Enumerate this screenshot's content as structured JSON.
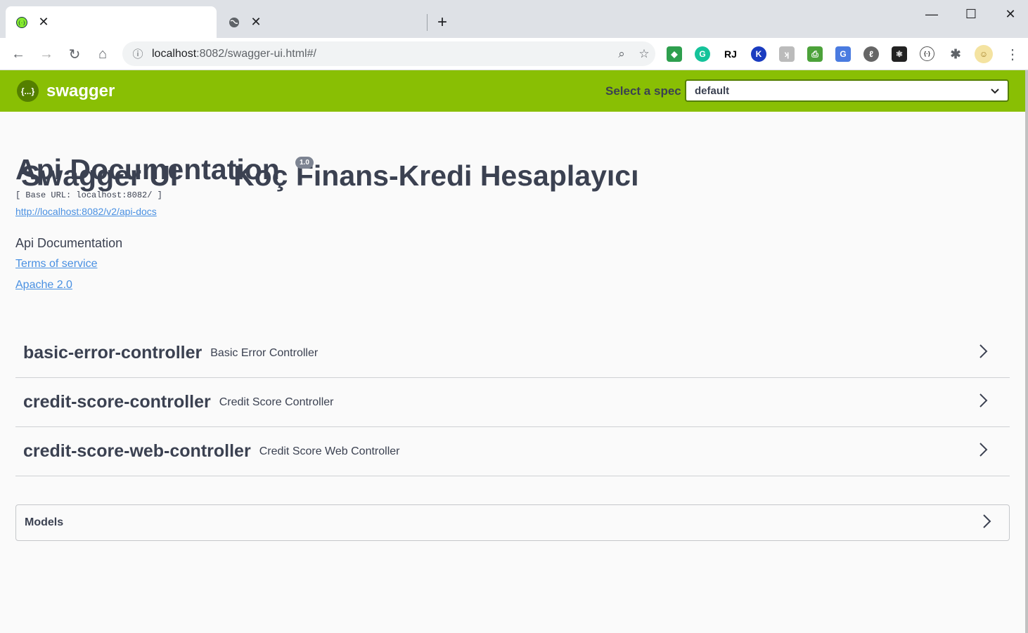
{
  "browser": {
    "tabs": [
      {
        "title": "Swagger UI",
        "active": true,
        "favicon": "swagger-icon"
      },
      {
        "title": "Koç Finans-Kredi Hesaplayıcı",
        "active": false,
        "favicon": "globe-icon"
      }
    ],
    "url_host": "localhost",
    "url_rest": ":8082/swagger-ui.html#/",
    "extensions": [
      "extension-1",
      "grammarly-icon",
      "rj-icon",
      "k-icon",
      "extension-5",
      "print-icon",
      "translate-icon",
      "extension-8",
      "react-icon",
      "swagger-ext-icon",
      "puzzle-icon",
      "profile-avatar"
    ]
  },
  "swagger": {
    "brand": "swagger",
    "logo_glyph": "{...}",
    "select_spec_label": "Select a spec",
    "selected_spec": "default"
  },
  "info": {
    "title": "Api Documentation",
    "version": "1.0",
    "base_url": "[ Base URL: localhost:8082/ ]",
    "docs_url": "http://localhost:8082/v2/api-docs",
    "description": "Api Documentation",
    "terms": "Terms of service",
    "license": "Apache 2.0"
  },
  "tags": [
    {
      "name": "basic-error-controller",
      "description": "Basic Error Controller"
    },
    {
      "name": "credit-score-controller",
      "description": "Credit Score Controller"
    },
    {
      "name": "credit-score-web-controller",
      "description": "Credit Score Web Controller"
    }
  ],
  "models": {
    "title": "Models"
  },
  "colors": {
    "swagger_green": "#89bf04",
    "text": "#3b4151",
    "link": "#4990e2"
  }
}
